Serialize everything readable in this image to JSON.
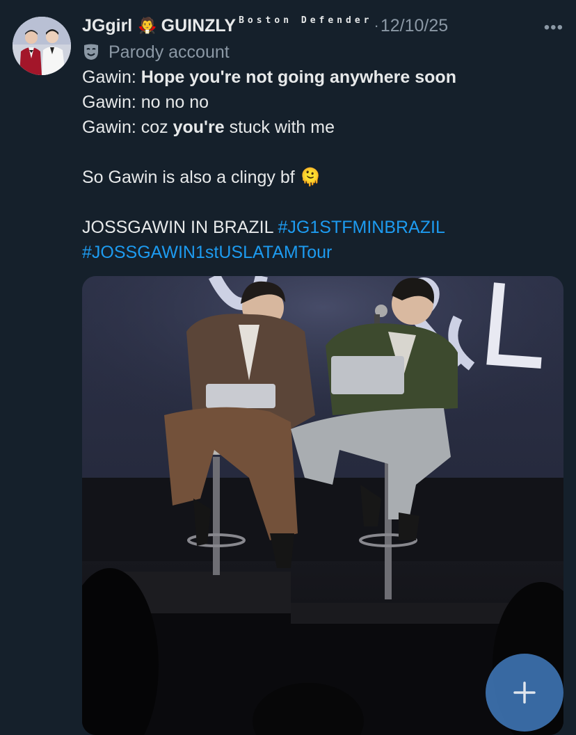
{
  "tweet": {
    "display_name": "JGgirl",
    "badge_emoji": "🧛",
    "display_name_2": "GUINZLY",
    "handle_tag": "Boston Defender",
    "separator": "·",
    "date": "12/10/25",
    "more_label": "•••",
    "parody_label": "Parody account",
    "lines": [
      {
        "prefix": "Gawin: ",
        "bold": "Hope you're not going anywhere soon",
        "suffix": ""
      },
      {
        "prefix": "Gawin: no no no",
        "bold": "",
        "suffix": ""
      },
      {
        "prefix": "Gawin: coz ",
        "bold": "you're",
        "suffix": " stuck with me"
      }
    ],
    "clingy_text": "So Gawin is also a clingy bf",
    "clingy_emoji": "🫠",
    "tour_text": "JOSSGAWIN IN BRAZIL ",
    "hashtag_1": "#JG1STFMINBRAZIL",
    "hashtag_2": "#JOSSGAWIN1stUSLATAMTour"
  },
  "icons": {
    "avatar": "avatar",
    "parody": "theater-mask-icon",
    "more": "more-icon",
    "compose": "plus-icon"
  },
  "colors": {
    "background": "#15202b",
    "text": "#e7e9ea",
    "muted": "#8b98a5",
    "hashtag": "#1d9bf0",
    "fab": "#4078b8"
  }
}
